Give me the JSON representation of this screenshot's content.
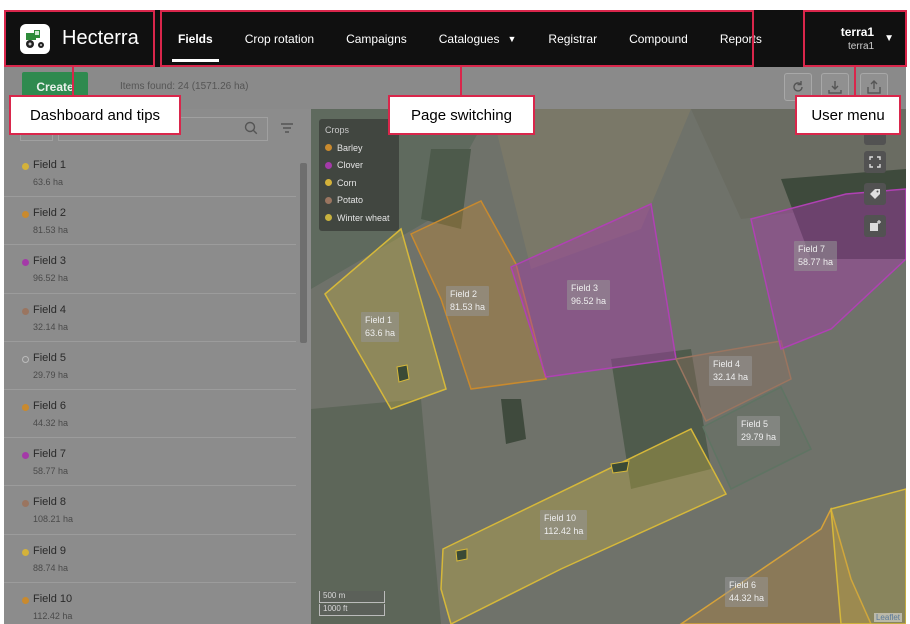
{
  "app": {
    "name": "Hecterra",
    "logo_icon": "tractor-icon"
  },
  "nav": {
    "items": [
      {
        "label": "Fields",
        "active": true
      },
      {
        "label": "Crop rotation",
        "active": false
      },
      {
        "label": "Campaigns",
        "active": false
      },
      {
        "label": "Catalogues",
        "active": false
      },
      {
        "label": "Registrar",
        "active": false
      },
      {
        "label": "Compound",
        "active": false
      },
      {
        "label": "Reports",
        "active": false
      }
    ]
  },
  "user": {
    "name": "terra1",
    "sub": "terra1"
  },
  "toolbar": {
    "create_label": "Create",
    "items_found": "Items found: 24 (1571.26 ha)"
  },
  "fields": [
    {
      "name": "Field 1",
      "area": "63.6 ha",
      "color": "#d4b23a"
    },
    {
      "name": "Field 2",
      "area": "81.53 ha",
      "color": "#c98a2e"
    },
    {
      "name": "Field 3",
      "area": "96.52 ha",
      "color": "#a43aa8"
    },
    {
      "name": "Field 4",
      "area": "32.14 ha",
      "color": "#9a7560"
    },
    {
      "name": "Field 5",
      "area": "29.79 ha",
      "color": "none"
    },
    {
      "name": "Field 6",
      "area": "44.32 ha",
      "color": "#c98a2e"
    },
    {
      "name": "Field 7",
      "area": "58.77 ha",
      "color": "#a43aa8"
    },
    {
      "name": "Field 8",
      "area": "108.21 ha",
      "color": "#9a7560"
    },
    {
      "name": "Field 9",
      "area": "88.74 ha",
      "color": "#d4b23a"
    },
    {
      "name": "Field 10",
      "area": "112.42 ha",
      "color": "#c98a2e"
    }
  ],
  "legend": {
    "title": "Crops",
    "items": [
      {
        "label": "Barley",
        "color": "#c98a2e"
      },
      {
        "label": "Clover",
        "color": "#a43aa8"
      },
      {
        "label": "Corn",
        "color": "#d4b23a"
      },
      {
        "label": "Potato",
        "color": "#9a7560"
      },
      {
        "label": "Winter wheat",
        "color": "#c8b23e"
      }
    ]
  },
  "map_labels": {
    "f1": {
      "name": "Field 1",
      "area": "63.6 ha"
    },
    "f2": {
      "name": "Field 2",
      "area": "81.53 ha"
    },
    "f3": {
      "name": "Field 3",
      "area": "96.52 ha"
    },
    "f4": {
      "name": "Field 4",
      "area": "32.14 ha"
    },
    "f5": {
      "name": "Field 5",
      "area": "29.79 ha"
    },
    "f6": {
      "name": "Field 6",
      "area": "44.32 ha"
    },
    "f7": {
      "name": "Field 7",
      "area": "58.77 ha"
    },
    "f10": {
      "name": "Field 10",
      "area": "112.42 ha"
    }
  },
  "scale": {
    "metric": "500 m",
    "imperial": "1000 ft"
  },
  "attribution": "Leaflet",
  "annotations": {
    "dashboard": "Dashboard and tips",
    "pages": "Page switching",
    "user_menu": "User menu"
  },
  "colors": {
    "annotation": "#d9264b",
    "topbar": "#101010"
  }
}
